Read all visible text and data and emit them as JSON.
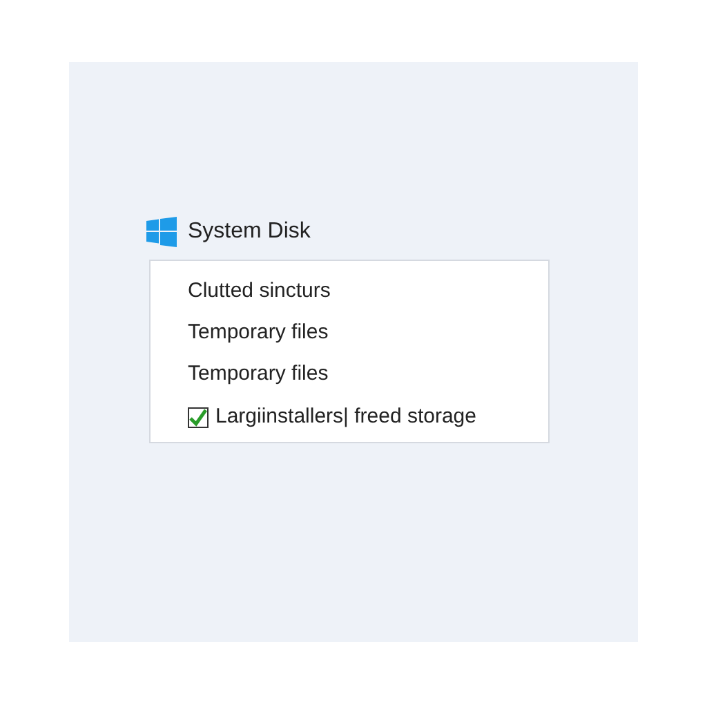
{
  "title": "System Disk",
  "items": [
    {
      "kind": "text",
      "label": "Clutted sincturs"
    },
    {
      "kind": "text",
      "label": "Temporary files"
    },
    {
      "kind": "text",
      "label": "Temporary files"
    },
    {
      "kind": "checkbox",
      "label": "Largiinstallers| freed storage",
      "checked": true
    }
  ]
}
